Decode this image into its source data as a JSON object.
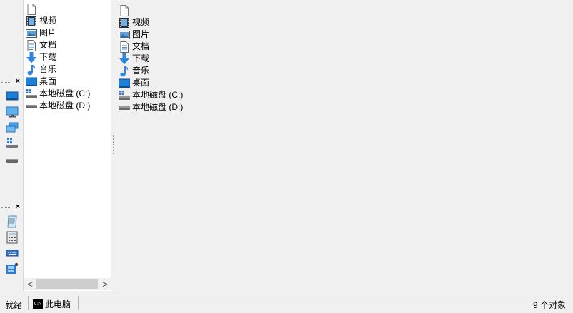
{
  "tree": {
    "items": [
      {
        "label": "",
        "icon": "blank-page-icon"
      },
      {
        "label": "视频",
        "icon": "video-icon"
      },
      {
        "label": "图片",
        "icon": "picture-icon"
      },
      {
        "label": "文档",
        "icon": "document-icon"
      },
      {
        "label": "下载",
        "icon": "download-arrow-icon"
      },
      {
        "label": "音乐",
        "icon": "music-note-icon"
      },
      {
        "label": "桌面",
        "icon": "desktop-icon"
      },
      {
        "label": "本地磁盘 (C:)",
        "icon": "system-drive-icon"
      },
      {
        "label": "本地磁盘 (D:)",
        "icon": "drive-icon"
      }
    ]
  },
  "files": {
    "items": [
      {
        "label": "",
        "icon": "blank-page-icon"
      },
      {
        "label": "视频",
        "icon": "video-icon"
      },
      {
        "label": "图片",
        "icon": "picture-icon"
      },
      {
        "label": "文档",
        "icon": "document-icon"
      },
      {
        "label": "下载",
        "icon": "download-arrow-icon"
      },
      {
        "label": "音乐",
        "icon": "music-note-icon"
      },
      {
        "label": "桌面",
        "icon": "desktop-icon"
      },
      {
        "label": "本地磁盘 (C:)",
        "icon": "system-drive-icon"
      },
      {
        "label": "本地磁盘 (D:)",
        "icon": "drive-icon"
      }
    ]
  },
  "toolbar": {
    "close_glyph": "×",
    "group1": [
      "desktop-icon",
      "monitor-icon",
      "network-icon",
      "system-drive-icon",
      "drive-icon"
    ],
    "group2": [
      "notepad-icon",
      "calculator-icon",
      "keyboard-icon",
      "control-panel-icon"
    ]
  },
  "scrollbar": {
    "left_arrow": "<",
    "right_arrow": ">"
  },
  "status": {
    "ready": "就绪",
    "location_icon_text": "C:\\",
    "location": "此电脑",
    "count": "9 个对象"
  }
}
